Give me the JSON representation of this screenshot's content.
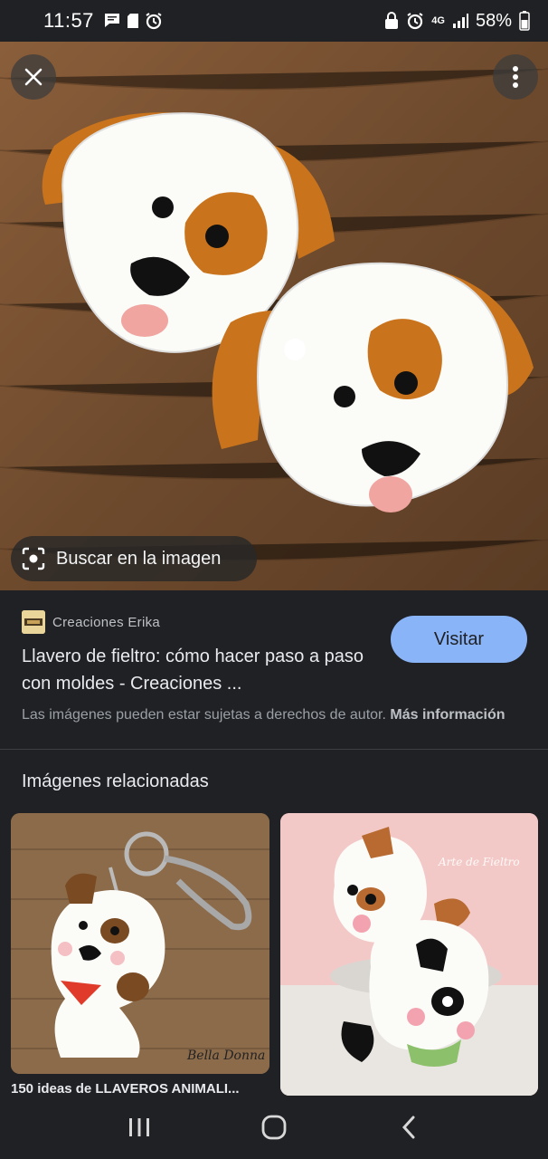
{
  "status_bar": {
    "time": "11:57",
    "battery": "58%",
    "network": "4G",
    "left_icons": [
      "message-icon",
      "sd-card-icon",
      "alarm-icon"
    ],
    "right_icons": [
      "lock-icon",
      "alarm-icon",
      "network-4g-icon",
      "signal-icon",
      "battery-icon"
    ]
  },
  "viewer": {
    "close_icon": "close-icon",
    "menu_icon": "more-vert-icon",
    "lens_label": "Buscar en la imagen"
  },
  "result": {
    "source_name": "Creaciones Erika",
    "title": "Llavero de fieltro: cómo hacer paso a paso con moldes - Creaciones ...",
    "visit_label": "Visitar",
    "copyright_text": "Las imágenes pueden estar sujetas a derechos de autor.",
    "more_info_label": "Más información"
  },
  "related": {
    "heading": "Imágenes relacionadas",
    "items": [
      {
        "caption": "150 ideas de LLAVEROS ANIMALI..."
      },
      {
        "caption": ""
      }
    ]
  },
  "colors": {
    "background": "#202124",
    "accent": "#8ab4f8"
  }
}
